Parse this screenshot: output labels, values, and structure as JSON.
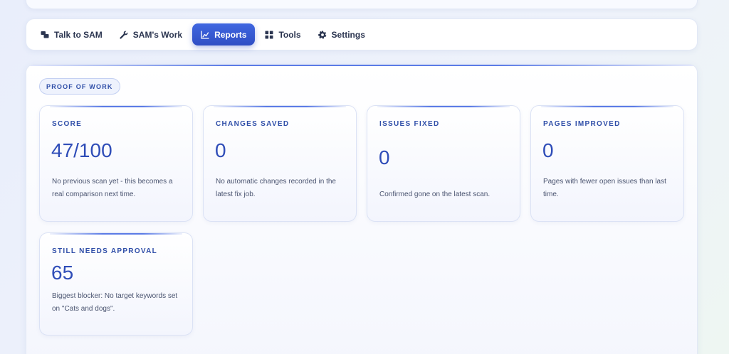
{
  "nav": {
    "tabs": [
      {
        "label": "Talk to SAM",
        "icon": "chat-icon"
      },
      {
        "label": "SAM's Work",
        "icon": "wrench-icon"
      },
      {
        "label": "Reports",
        "icon": "chart-icon"
      },
      {
        "label": "Tools",
        "icon": "grid-icon"
      },
      {
        "label": "Settings",
        "icon": "gear-icon"
      }
    ],
    "active_tab": "Reports"
  },
  "panel": {
    "badge": "PROOF OF WORK",
    "cards": [
      {
        "label": "SCORE",
        "value": "47/100",
        "description": "No previous scan yet - this becomes a real comparison next time."
      },
      {
        "label": "CHANGES SAVED",
        "value": "0",
        "description": "No automatic changes recorded in the latest fix job."
      },
      {
        "label": "ISSUES FIXED",
        "value": "0",
        "description": "Confirmed gone on the latest scan."
      },
      {
        "label": "PAGES IMPROVED",
        "value": "0",
        "description": "Pages with fewer open issues than last time."
      },
      {
        "label": "STILL NEEDS APPROVAL",
        "value": "65",
        "description": "Biggest blocker: No target keywords set on \"Cats and dogs\"."
      }
    ]
  },
  "colors": {
    "accent": "#2f4ec4",
    "value_text": "#2f4db8",
    "label_text": "#2f4ea8"
  }
}
